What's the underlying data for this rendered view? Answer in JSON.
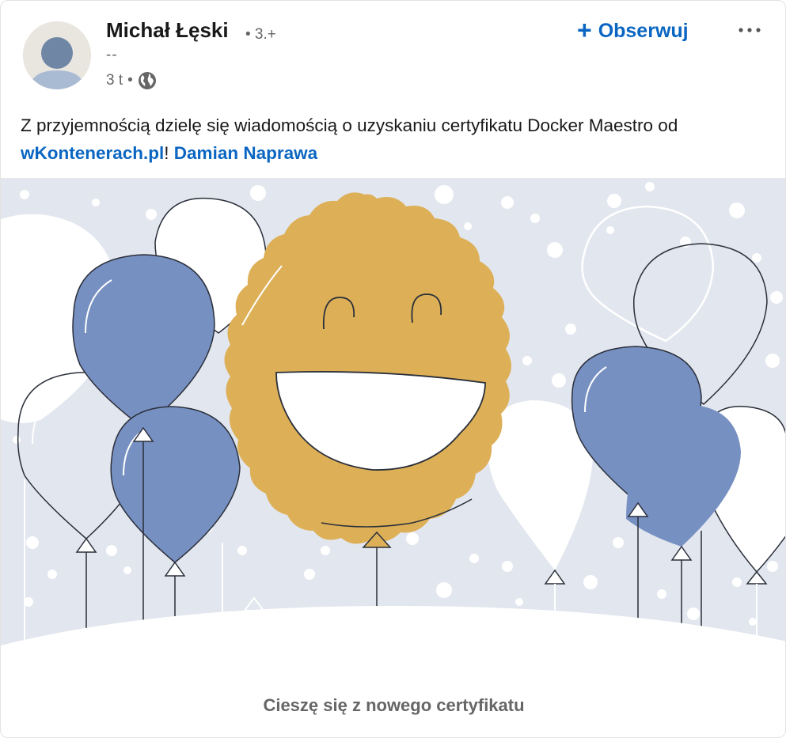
{
  "author": {
    "name": "Michał Łęski",
    "degree": "• 3.+",
    "headline": "--",
    "time": "3 t",
    "separator": "•",
    "visibility_icon": "globe-icon"
  },
  "actions": {
    "follow_label": "Obserwuj",
    "follow_icon": "plus-icon",
    "more_icon": "ellipsis-icon"
  },
  "post": {
    "text_before": "Z przyjemnością dzielę się wiadomością o uzyskaniu certyfikatu Docker Maestro od ",
    "link_company": "wKontenerach.pl",
    "text_mid": "! ",
    "link_person": "Damian Naprawa"
  },
  "image": {
    "description_icon": "smiling-badge-with-balloons-illustration",
    "colors": {
      "background": "#e2e6ee",
      "gold": "#ddb058",
      "blue": "#7790c2",
      "outline": "#2a2f3a"
    }
  },
  "caption": "Cieszę się z nowego certyfikatu",
  "colors": {
    "link": "#0a66c2",
    "muted": "#666666",
    "text": "#191919"
  }
}
